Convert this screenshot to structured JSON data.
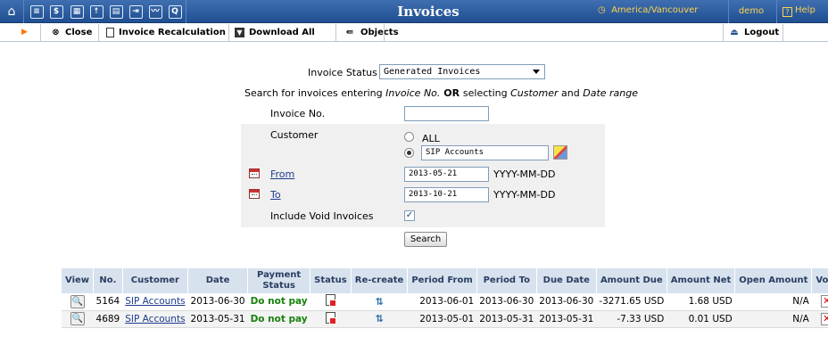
{
  "app": {
    "title": "Invoices",
    "timezone": "America/Vancouver",
    "user": "demo",
    "help": "Help"
  },
  "topnav": {
    "icons": [
      "home-icon",
      "list-icon",
      "dollar-icon",
      "grid-icon",
      "person-icon",
      "card-icon",
      "transfer-icon",
      "chart-icon",
      "search-icon"
    ]
  },
  "toolbar": {
    "close": "Close",
    "invoice_recalc": "Invoice Recalculation",
    "download_all": "Download All",
    "objects": "Objects",
    "logout": "Logout"
  },
  "form": {
    "invoice_status_label": "Invoice Status",
    "invoice_status_value": "Generated Invoices",
    "search_hint_prefix": "Search for invoices entering ",
    "search_hint_inv": "Invoice No.",
    "search_hint_or": " OR ",
    "search_hint_mid": "selecting ",
    "search_hint_customer": "Customer",
    "search_hint_and": " and ",
    "search_hint_date": "Date range",
    "invoice_no_label": "Invoice No.",
    "invoice_no_value": "",
    "customer_label": "Customer",
    "customer_all": "ALL",
    "customer_value": "SIP Accounts",
    "from_label": "From",
    "from_value": "2013-05-21",
    "to_label": "To",
    "to_value": "2013-10-21",
    "date_format": "YYYY-MM-DD",
    "include_void_label": "Include Void Invoices",
    "include_void_checked": true,
    "search_button": "Search"
  },
  "table": {
    "columns": [
      "View",
      "No.",
      "Customer",
      "Date",
      "Payment Status",
      "Status",
      "Re-create",
      "Period From",
      "Period To",
      "Due Date",
      "Amount Due",
      "Amount Net",
      "Open Amount",
      "Void"
    ],
    "rows": [
      {
        "no": "5164",
        "customer": "SIP Accounts",
        "date": "2013-06-30",
        "payment_status": "Do not pay",
        "period_from": "2013-06-01",
        "period_to": "2013-06-30",
        "due_date": "2013-06-30",
        "amount_due": "-3271.65 USD",
        "amount_net": "1.68 USD",
        "open_amount": "N/A"
      },
      {
        "no": "4689",
        "customer": "SIP Accounts",
        "date": "2013-05-31",
        "payment_status": "Do not pay",
        "period_from": "2013-05-01",
        "period_to": "2013-05-31",
        "due_date": "2013-05-31",
        "amount_due": "-7.33 USD",
        "amount_net": "0.01 USD",
        "open_amount": "N/A"
      }
    ]
  },
  "colors": {
    "topbar": "#2b5ba0",
    "accent": "#ffd24a",
    "table_header": "#d7e2ee",
    "do_not_pay": "#19810e"
  }
}
